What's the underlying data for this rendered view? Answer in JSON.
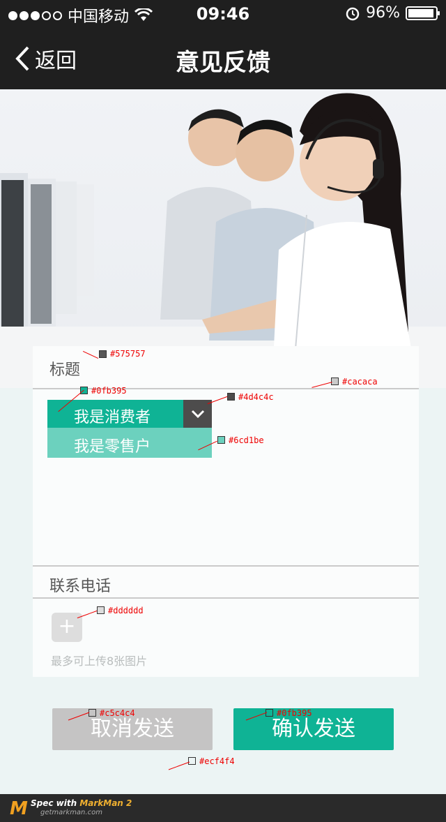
{
  "status": {
    "carrier": "中国移动",
    "time": "09:46",
    "battery": "96%",
    "battery_level": 0.96,
    "icons": [
      "signal-dots-icon",
      "wifi-icon",
      "alarm-icon",
      "battery-icon"
    ]
  },
  "nav": {
    "back_label": "返回",
    "title": "意见反馈"
  },
  "form": {
    "title_label": "标题",
    "select_value": "我是消费者",
    "select_option": "我是零售户",
    "phone_label": "联系电话",
    "upload_icon": "+",
    "upload_hint": "最多可上传8张图片"
  },
  "buttons": {
    "cancel": "取消发送",
    "confirm": "确认发送"
  },
  "annotations": {
    "c1": "#575757",
    "c2": "#0fb395",
    "c3": "#4d4c4c",
    "c4": "#cacaca",
    "c5": "#6cd1be",
    "c6": "#dddddd",
    "c7": "#c5c4c4",
    "c8": "#0fb395",
    "c9": "#ecf4f4"
  },
  "footer": {
    "logo": "M",
    "spec_prefix": "Spec with ",
    "brand": "MarkMan 2",
    "site": "getmarkman.com"
  },
  "colors": {
    "primary": "#0fb395",
    "option": "#6cd1be",
    "arrow_bg": "#4d4c4c",
    "cancel_bg": "#c5c4c4",
    "page_bg": "#ecf4f4",
    "label_text": "#575757",
    "divider": "#cacaca",
    "upload_bg": "#dddddd"
  }
}
